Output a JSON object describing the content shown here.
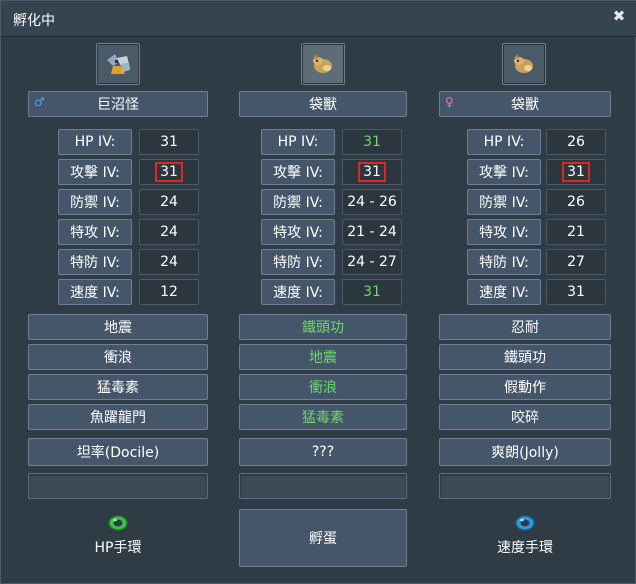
{
  "window": {
    "title": "孵化中",
    "close_symbol": "✖"
  },
  "columns": [
    {
      "name": "巨沼怪",
      "gender_symbol": "♂",
      "gender": "male",
      "icon": "pokemon-icon",
      "iv_labels": [
        "HP IV:",
        "攻擊 IV:",
        "防禦 IV:",
        "特攻 IV:",
        "特防 IV:",
        "速度 IV:"
      ],
      "iv_values": [
        "31",
        "31",
        "24",
        "24",
        "24",
        "12"
      ],
      "moves": [
        "地震",
        "衝浪",
        "猛毒素",
        "魚躍龍門"
      ],
      "nature": "坦率(Docile)"
    },
    {
      "name": "袋獸",
      "gender_symbol": "",
      "gender": "none",
      "icon": "pokemon-icon",
      "iv_labels": [
        "HP IV:",
        "攻擊 IV:",
        "防禦 IV:",
        "特攻 IV:",
        "特防 IV:",
        "速度 IV:"
      ],
      "iv_values": [
        "31",
        "31",
        "24 - 26",
        "21 - 24",
        "24 - 27",
        "31"
      ],
      "moves": [
        "鐵頭功",
        "地震",
        "衝浪",
        "猛毒素"
      ],
      "nature": "???"
    },
    {
      "name": "袋獸",
      "gender_symbol": "♀",
      "gender": "female",
      "icon": "pokemon-icon",
      "iv_labels": [
        "HP IV:",
        "攻擊 IV:",
        "防禦 IV:",
        "特攻 IV:",
        "特防 IV:",
        "速度 IV:"
      ],
      "iv_values": [
        "26",
        "31",
        "26",
        "21",
        "27",
        "31"
      ],
      "moves": [
        "忍耐",
        "鐵頭功",
        "假動作",
        "咬碎"
      ],
      "nature": "爽朗(Jolly)"
    }
  ],
  "items": {
    "left": {
      "label": "HP手環",
      "color": "#3fc24a",
      "icon": "power-band-icon"
    },
    "right": {
      "label": "速度手環",
      "color": "#2f9be0",
      "icon": "power-band-icon"
    }
  },
  "hatch_button": "孵蛋",
  "colors": {
    "highlight_box": "#e02525",
    "green_text": "#6bd96b"
  }
}
